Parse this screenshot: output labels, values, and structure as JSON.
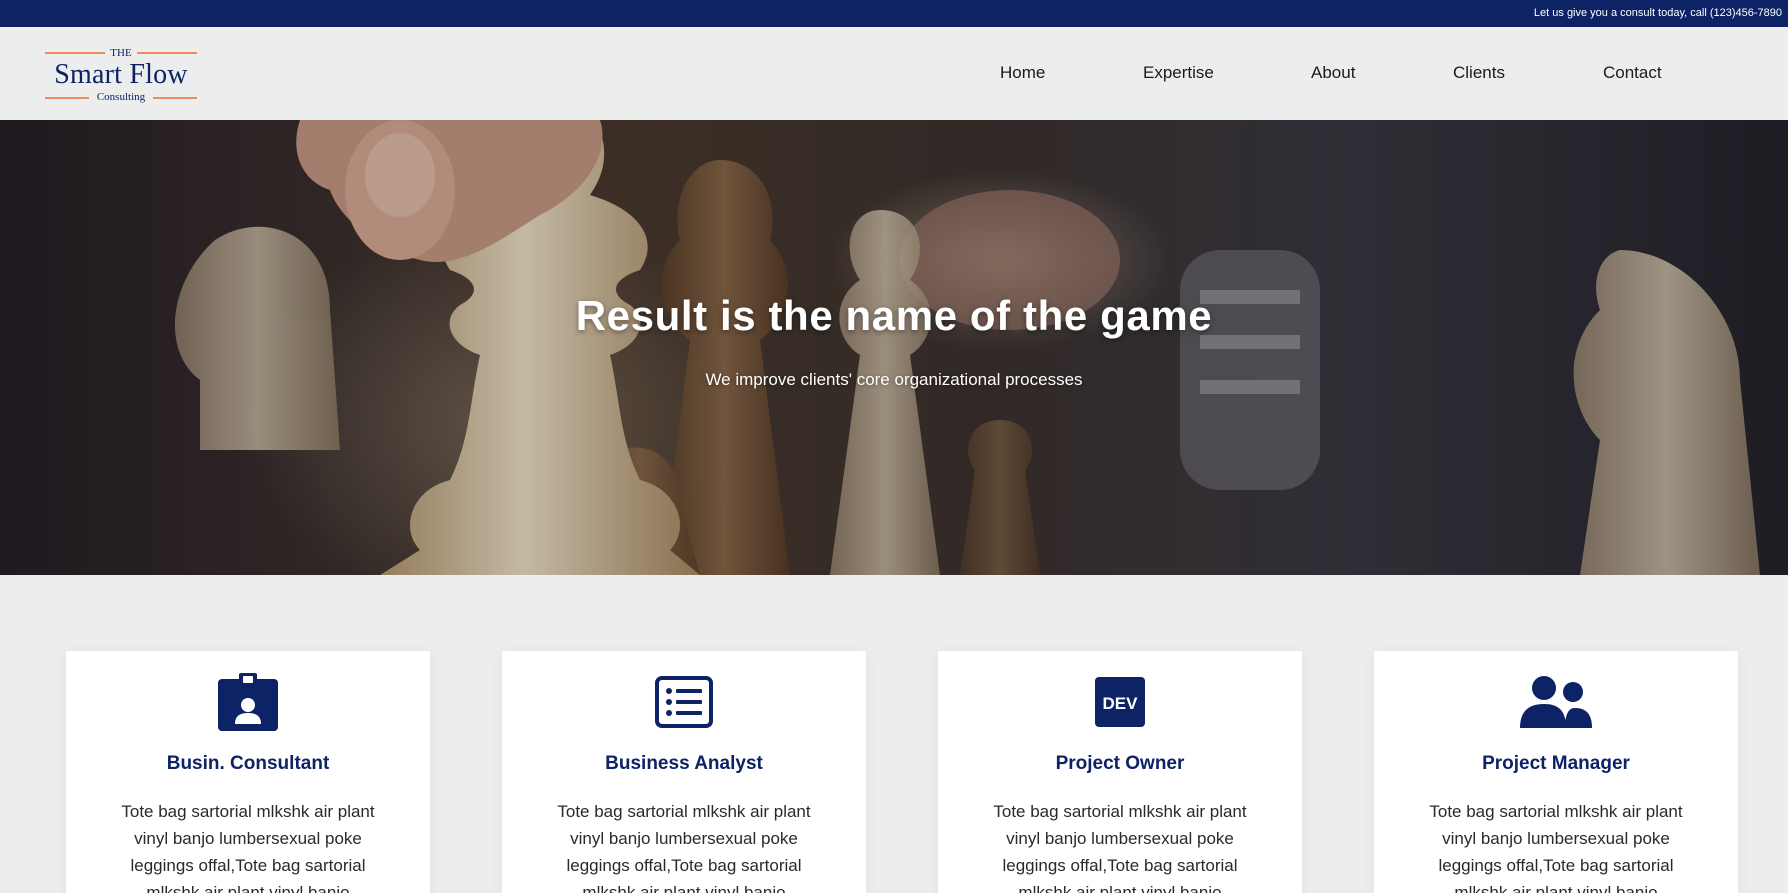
{
  "topbar": {
    "text": "Let us give you a consult today, call (123)456-7890"
  },
  "logo": {
    "the": "THE",
    "name": "Smart Flow",
    "sub": "Consulting",
    "accent_color": "#f08a5d"
  },
  "nav": {
    "items": [
      {
        "label": "Home"
      },
      {
        "label": "Expertise"
      },
      {
        "label": "About"
      },
      {
        "label": "Clients"
      },
      {
        "label": "Contact"
      }
    ]
  },
  "hero": {
    "title": "Result is the name of the game",
    "subtitle": "We improve clients' core organizational processes",
    "image_description": "chess-pieces-background"
  },
  "cards": [
    {
      "icon": "id-badge-icon",
      "title": "Busin. Consultant",
      "text": "Tote bag sartorial mlkshk air plant vinyl banjo lumbersexual poke leggings offal,Tote bag sartorial mlkshk air plant vinyl banjo"
    },
    {
      "icon": "list-alt-icon",
      "title": "Business Analyst",
      "text": "Tote bag sartorial mlkshk air plant vinyl banjo lumbersexual poke leggings offal,Tote bag sartorial mlkshk air plant vinyl banjo"
    },
    {
      "icon": "dev-icon",
      "title": "Project Owner",
      "text": "Tote bag sartorial mlkshk air plant vinyl banjo lumbersexual poke leggings offal,Tote bag sartorial mlkshk air plant vinyl banjo"
    },
    {
      "icon": "users-icon",
      "title": "Project Manager",
      "text": "Tote bag sartorial mlkshk air plant vinyl banjo lumbersexual poke leggings offal,Tote bag sartorial mlkshk air plant vinyl banjo"
    }
  ],
  "colors": {
    "brand_navy": "#0d2366",
    "page_background": "#eceeed",
    "accent_orange": "#f08a5d"
  }
}
